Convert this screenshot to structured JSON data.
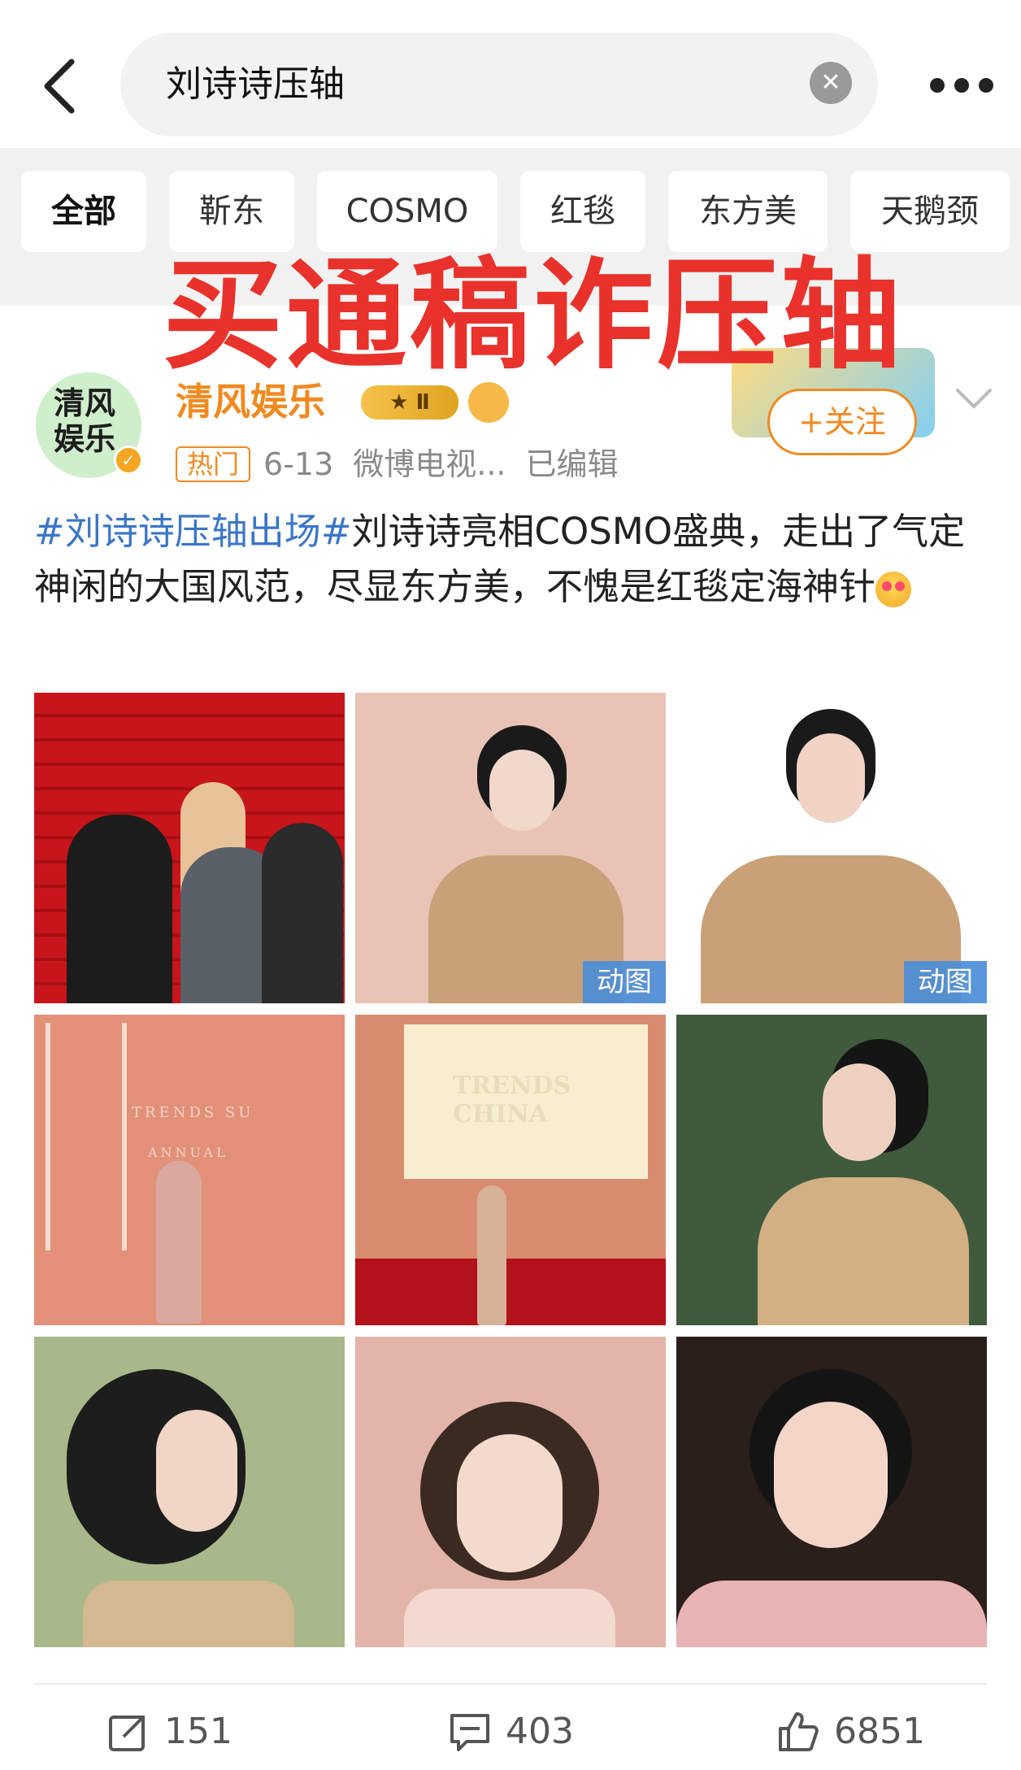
{
  "search": {
    "query": "刘诗诗压轴",
    "clear_icon": "close-icon",
    "back_icon": "chevron-left-icon",
    "more_icon": "more-horizontal-icon"
  },
  "tabs": [
    {
      "label": "全部",
      "active": true
    },
    {
      "label": "靳东",
      "active": false
    },
    {
      "label": "COSMO",
      "active": false
    },
    {
      "label": "红毯",
      "active": false
    },
    {
      "label": "东方美",
      "active": false
    },
    {
      "label": "天鹅颈",
      "active": false
    }
  ],
  "overlay": {
    "title": "买通稿诈压轴",
    "color": "#e8322b"
  },
  "post": {
    "avatar_text": "清风娱乐",
    "username": "清风娱乐",
    "vip_level": "Ⅱ",
    "follow_label": "+关注",
    "hot_tag": "热门",
    "date": "6-13",
    "source": "微博电视...",
    "edited": "已编辑",
    "hashtag": "#刘诗诗压轴出场#",
    "body": "刘诗诗亮相COSMO盛典，走出了气定神闲的大国风范，尽显东方美，不愧是红毯定海神针",
    "accent_color": "#f08a20",
    "link_color": "#3b76c7"
  },
  "images": [
    {
      "gif_label": ""
    },
    {
      "gif_label": "动图"
    },
    {
      "gif_label": "动图"
    },
    {
      "gif_label": "",
      "caption": "TRENDS SU",
      "caption2": "ANNUAL"
    },
    {
      "gif_label": "",
      "caption": "TRENDS CHINA"
    },
    {
      "gif_label": ""
    },
    {
      "gif_label": ""
    },
    {
      "gif_label": ""
    },
    {
      "gif_label": ""
    }
  ],
  "actions": {
    "reposts": "151",
    "comments": "403",
    "likes": "6851"
  }
}
